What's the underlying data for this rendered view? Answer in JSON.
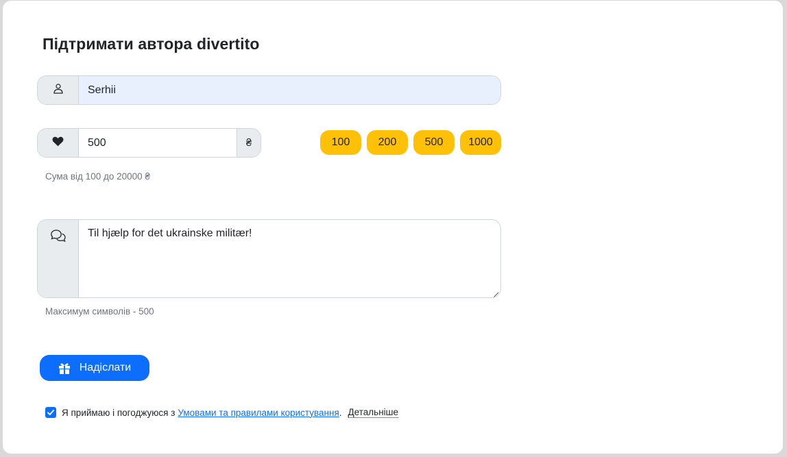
{
  "form": {
    "title": "Підтримати автора divertito",
    "name_value": "Serhii",
    "amount_value": "500",
    "currency_symbol": "₴",
    "amount_hint": "Сума від 100 до 20000 ₴",
    "preset_amounts": [
      "100",
      "200",
      "500",
      "1000"
    ],
    "message_value": "Til hjælp for det ukrainske militær!",
    "message_hint": "Максимум символів - 500",
    "submit_label": "Надіслати"
  },
  "consent": {
    "checked": true,
    "text": "Я приймаю і погоджуюся з",
    "link_text": "Умовами та правилами користування",
    "separator": ".",
    "details_text": "Детальніше"
  },
  "icons": {
    "name_icon": "person-icon",
    "amount_icon": "heart-icon",
    "message_icon": "chat-bubbles-icon",
    "submit_icon": "gift-icon"
  },
  "colors": {
    "primary": "#0d6efd",
    "preset_button": "#ffc107",
    "addon_bg": "#e9ecef",
    "autofill_bg": "#e8f0fe"
  }
}
